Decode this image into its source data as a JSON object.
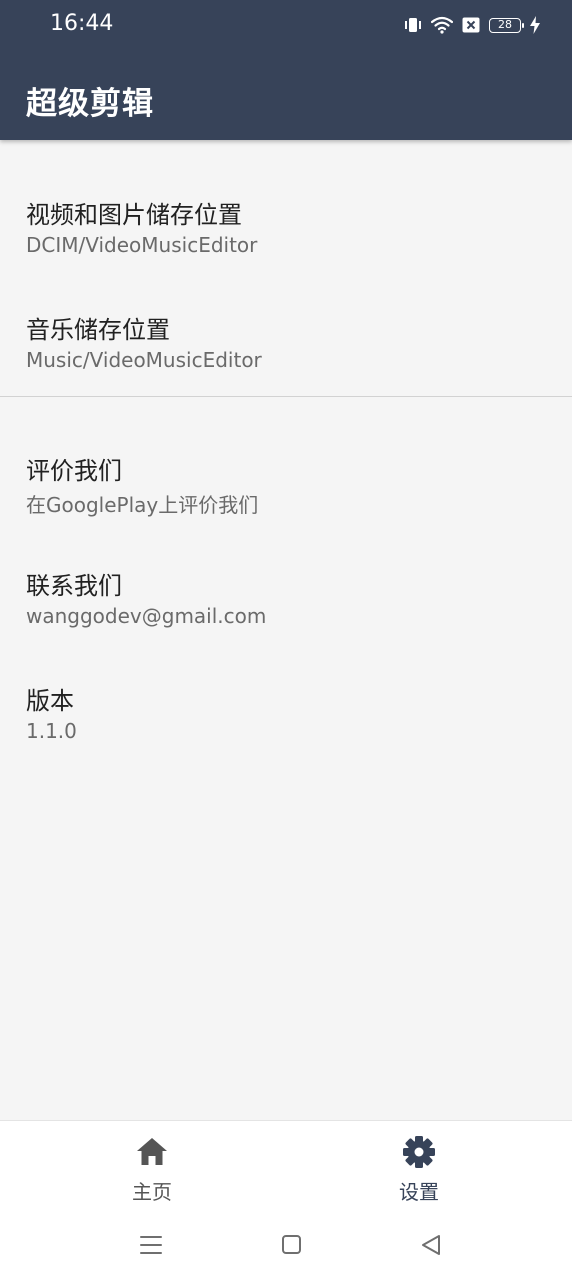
{
  "status_bar": {
    "time": "16:44",
    "battery_level": "28",
    "icons": [
      "vibrate-icon",
      "wifi-icon",
      "sim-blocked-icon",
      "battery-icon",
      "charging-icon"
    ]
  },
  "app_bar": {
    "title": "超级剪辑",
    "background_color": "#374359"
  },
  "settings": {
    "items": [
      {
        "title": "视频和图片储存位置",
        "summary": "DCIM/VideoMusicEditor"
      },
      {
        "title": "音乐储存位置",
        "summary": "Music/VideoMusicEditor"
      },
      {
        "title": "评价我们",
        "summary": "在GooglePlay上评价我们"
      },
      {
        "title": "联系我们",
        "summary": "wanggodev@gmail.com"
      },
      {
        "title": "版本",
        "summary": "1.1.0"
      }
    ]
  },
  "bottom_nav": {
    "items": [
      {
        "label": "主页",
        "icon": "home-icon",
        "selected": false,
        "color": "#555555"
      },
      {
        "label": "设置",
        "icon": "gear-icon",
        "selected": true,
        "color": "#374359"
      }
    ]
  },
  "system_nav": {
    "icons": [
      "menu-icon",
      "home-square-icon",
      "back-triangle-icon"
    ]
  }
}
